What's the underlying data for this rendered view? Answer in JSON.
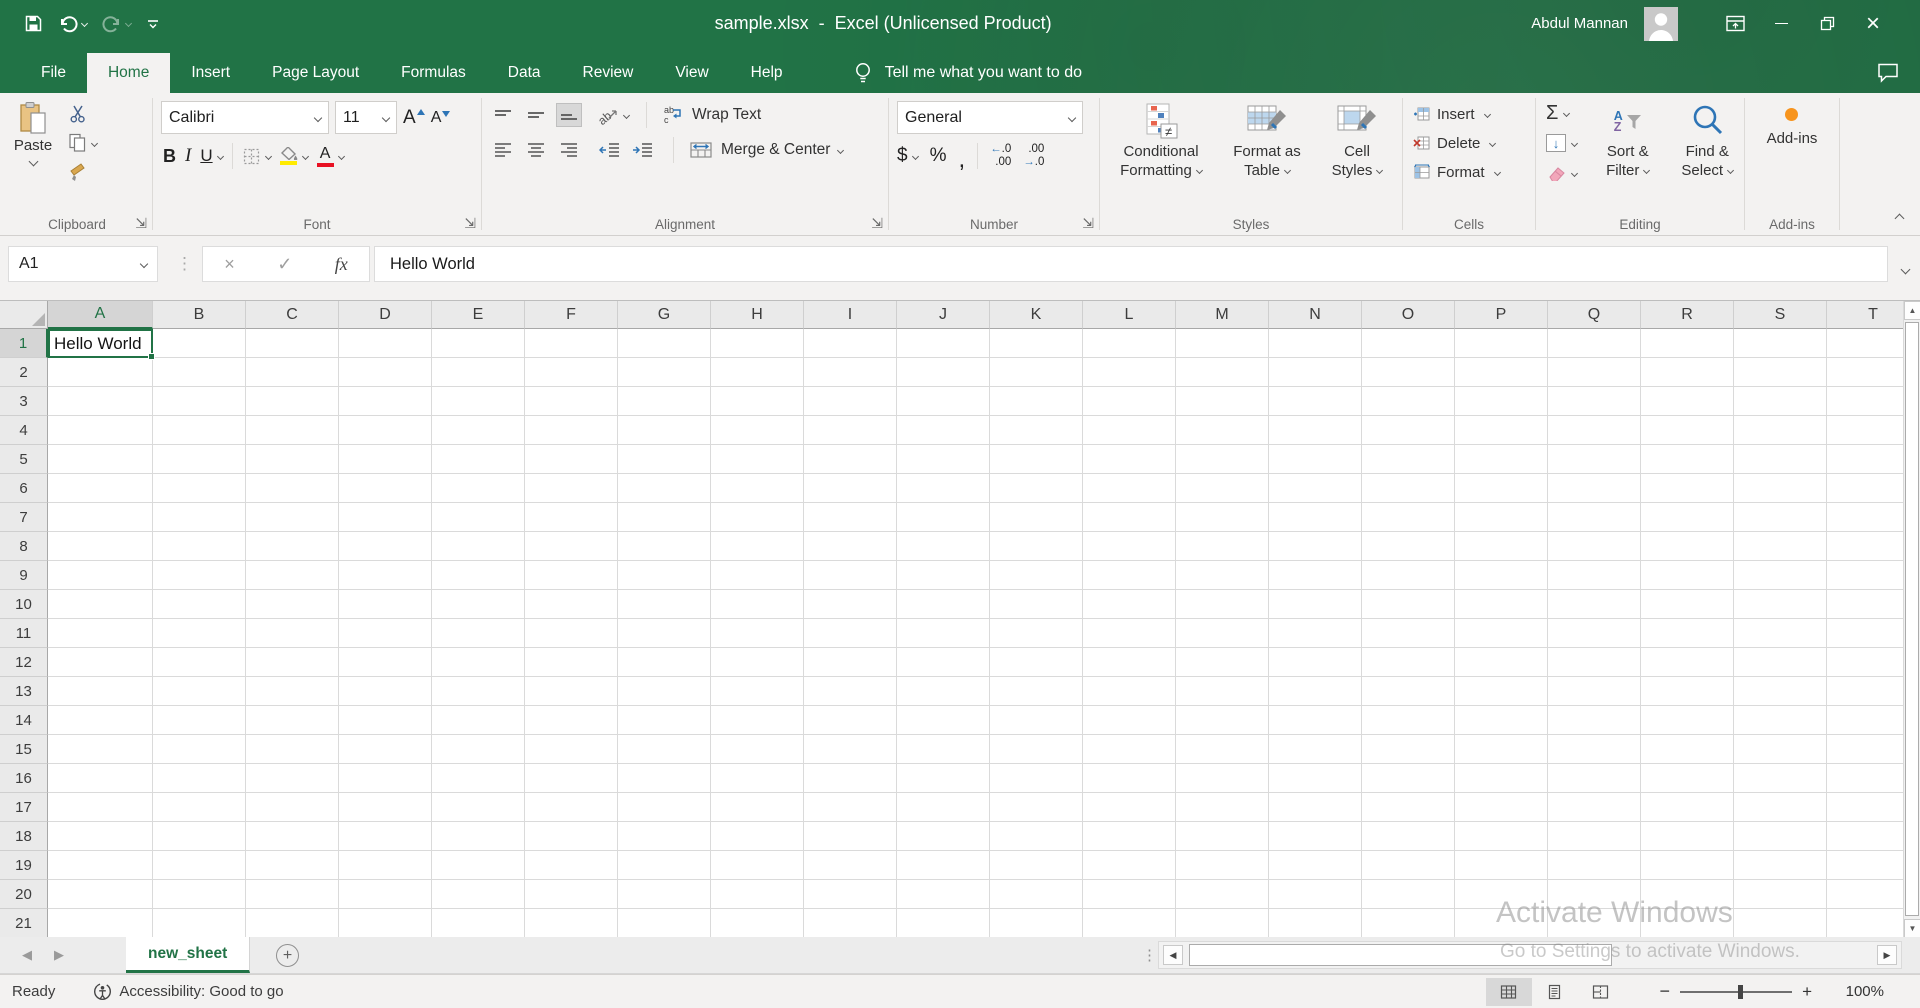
{
  "colors": {
    "excel_green": "#217346",
    "fill_yellow": "#ffeb00",
    "font_red": "#e81123",
    "addin_orange": "#f7941d",
    "accent_blue": "#2e75b6"
  },
  "titlebar": {
    "title": "sample.xlsx  -  Excel (Unlicensed Product)",
    "user": "Abdul Mannan"
  },
  "tabs": {
    "items": [
      "File",
      "Home",
      "Insert",
      "Page Layout",
      "Formulas",
      "Data",
      "Review",
      "View",
      "Help"
    ],
    "active": "Home",
    "tell_me": "Tell me what you want to do"
  },
  "ribbon": {
    "clipboard": {
      "label": "Clipboard",
      "paste": "Paste"
    },
    "font": {
      "label": "Font",
      "name": "Calibri",
      "size": "11",
      "bold": "B",
      "italic": "I",
      "underline": "U",
      "grow_glyph": "A",
      "shrink_glyph": "A",
      "color_glyph": "A"
    },
    "alignment": {
      "label": "Alignment",
      "wrap": "Wrap Text",
      "merge": "Merge & Center",
      "orientation_glyph": "ab",
      "wrap_glyph": [
        "ab",
        "c"
      ]
    },
    "number": {
      "label": "Number",
      "format": "General",
      "currency": "$",
      "percent": "%",
      "comma": ",",
      "inc_top": ".0",
      "inc_bottom": ".00",
      "dec_top": ".00",
      "dec_bottom": ".0"
    },
    "styles": {
      "label": "Styles",
      "conditional": [
        "Conditional",
        "Formatting"
      ],
      "format_table": [
        "Format as",
        "Table"
      ],
      "cell_styles": [
        "Cell",
        "Styles"
      ]
    },
    "cells": {
      "label": "Cells",
      "insert": "Insert",
      "delete": "Delete",
      "format": "Format"
    },
    "editing": {
      "label": "Editing",
      "sort": [
        "Sort &",
        "Filter"
      ],
      "find": [
        "Find &",
        "Select"
      ],
      "az": {
        "a": "A",
        "z": "Z"
      }
    },
    "addins": {
      "label": "Add-ins",
      "button": "Add-ins"
    }
  },
  "formula_bar": {
    "name_box": "A1",
    "fx": "fx",
    "content": "Hello World"
  },
  "sheet": {
    "columns": [
      "A",
      "B",
      "C",
      "D",
      "E",
      "F",
      "G",
      "H",
      "I",
      "J",
      "K",
      "L",
      "M",
      "N",
      "O",
      "P",
      "Q",
      "R",
      "S",
      "T"
    ],
    "rows": [
      "1",
      "2",
      "3",
      "4",
      "5",
      "6",
      "7",
      "8",
      "9",
      "10",
      "11",
      "12",
      "13",
      "14",
      "15",
      "16",
      "17",
      "18",
      "19",
      "20",
      "21"
    ],
    "active_cell": {
      "ref": "A1",
      "column": "A",
      "row": "1",
      "value": "Hello World"
    }
  },
  "sheet_tabs": {
    "active": "new_sheet"
  },
  "status_bar": {
    "mode": "Ready",
    "accessibility": "Accessibility: Good to go",
    "zoom": "100%"
  },
  "watermark": {
    "line1": "Activate Windows",
    "line2": "Go to Settings to activate Windows."
  }
}
